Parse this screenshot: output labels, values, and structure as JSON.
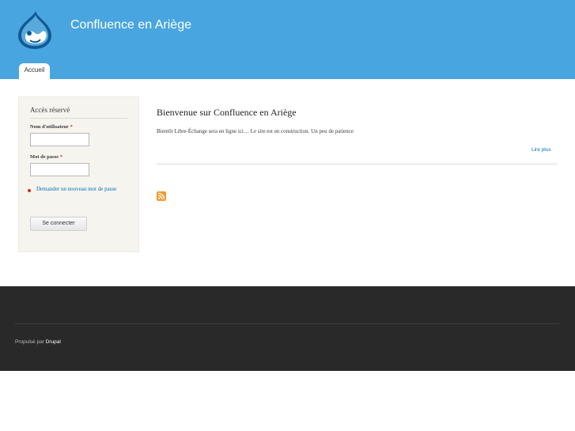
{
  "header": {
    "site_name": "Confluence en Ariège",
    "logo_icon": "drupal-drop-icon",
    "tabs": [
      {
        "label": "Accueil",
        "active": true
      }
    ],
    "background_color": "#49a5e0"
  },
  "sidebar": {
    "block_title": "Accès réservé",
    "username_label": "Nom d'utilisateur",
    "password_label": "Mot de passe",
    "required_marker": "*",
    "username_value": "",
    "password_value": "",
    "links": [
      {
        "label": "Demander un nouveau mot de passe"
      }
    ],
    "submit_label": "Se connecter"
  },
  "main": {
    "node_title": "Bienvenue sur Confluence en Ariège",
    "node_body": "Bientôt Libre-Échange sera en ligne ici… Le site est en construction. Un peu de patience",
    "read_more": "Lire plus",
    "feed_icon": "rss-feed-icon"
  },
  "footer": {
    "powered_prefix": "Propulsé par",
    "powered_link": "Drupal",
    "background_color": "#292929"
  },
  "colors": {
    "link": "#0071b3",
    "required": "#e32700"
  }
}
